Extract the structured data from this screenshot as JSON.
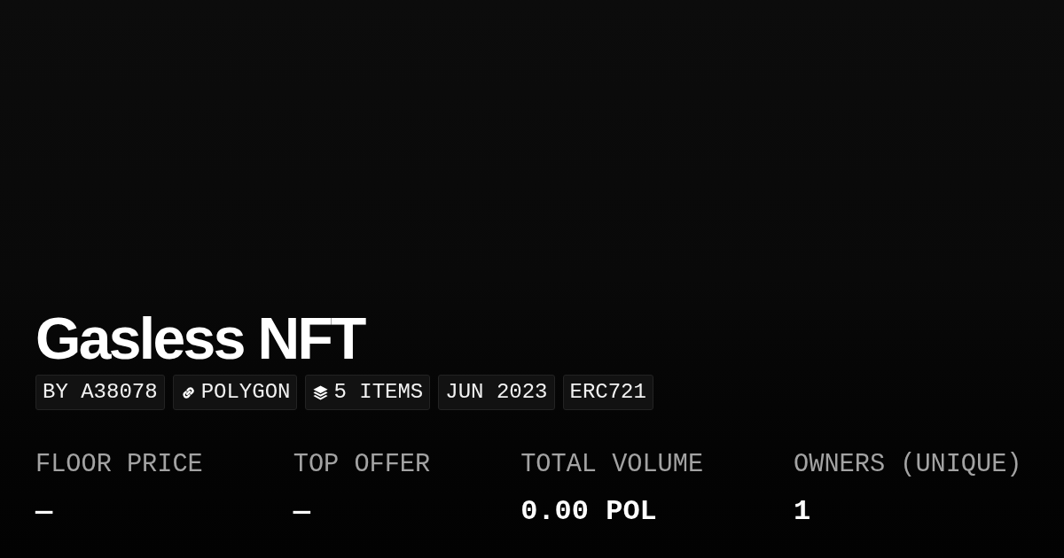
{
  "collection": {
    "title": "Gasless NFT"
  },
  "badges": [
    {
      "kind": "text",
      "label": "BY A38078"
    },
    {
      "kind": "link",
      "label": "POLYGON"
    },
    {
      "kind": "layers",
      "label": "5 ITEMS"
    },
    {
      "kind": "text",
      "label": "JUN 2023"
    },
    {
      "kind": "text",
      "label": "ERC721"
    }
  ],
  "stats": [
    {
      "label": "FLOOR PRICE",
      "value": "—"
    },
    {
      "label": "TOP OFFER",
      "value": "—"
    },
    {
      "label": "TOTAL VOLUME",
      "value": "0.00 POL"
    },
    {
      "label": "OWNERS (UNIQUE)",
      "value": "1"
    }
  ]
}
